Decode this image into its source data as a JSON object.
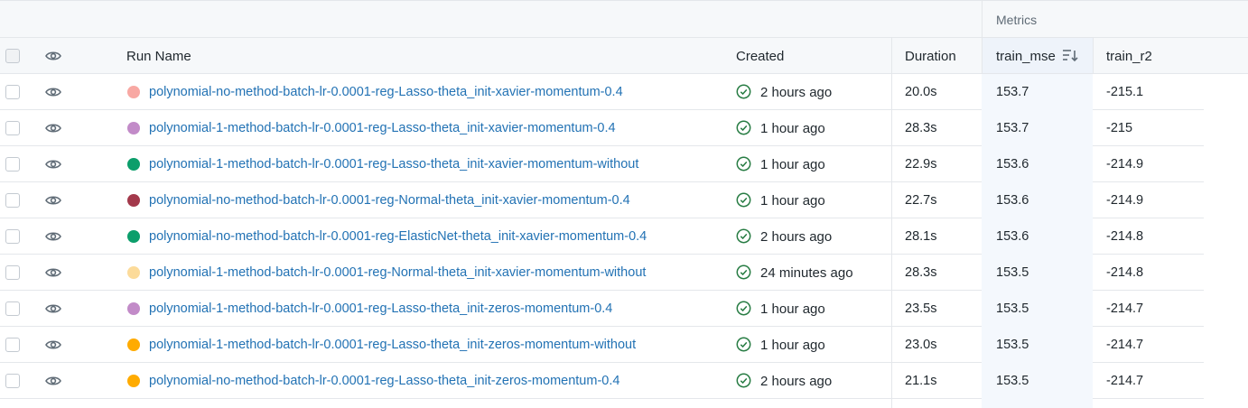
{
  "group_header": {
    "metrics": "Metrics"
  },
  "columns": {
    "run_name": "Run Name",
    "created": "Created",
    "duration": "Duration",
    "train_mse": "train_mse",
    "train_r2": "train_r2"
  },
  "sorted_column": "train_mse",
  "colors": {
    "link": "#2272b4",
    "status_success": "#277c43"
  },
  "rows": [
    {
      "name": "polynomial-no-method-batch-lr-0.0001-reg-Lasso-theta_init-xavier-momentum-0.4",
      "color": "#f8a8a3",
      "created": "2 hours ago",
      "duration": "20.0s",
      "train_mse": "153.7",
      "train_r2": "-215.1"
    },
    {
      "name": "polynomial-1-method-batch-lr-0.0001-reg-Lasso-theta_init-xavier-momentum-0.4",
      "color": "#c28bc8",
      "created": "1 hour ago",
      "duration": "28.3s",
      "train_mse": "153.7",
      "train_r2": "-215"
    },
    {
      "name": "polynomial-1-method-batch-lr-0.0001-reg-Lasso-theta_init-xavier-momentum-without",
      "color": "#0c9e6b",
      "created": "1 hour ago",
      "duration": "22.9s",
      "train_mse": "153.6",
      "train_r2": "-214.9"
    },
    {
      "name": "polynomial-no-method-batch-lr-0.0001-reg-Normal-theta_init-xavier-momentum-0.4",
      "color": "#a3394b",
      "created": "1 hour ago",
      "duration": "22.7s",
      "train_mse": "153.6",
      "train_r2": "-214.9"
    },
    {
      "name": "polynomial-no-method-batch-lr-0.0001-reg-ElasticNet-theta_init-xavier-momentum-0.4",
      "color": "#0c9e6b",
      "created": "2 hours ago",
      "duration": "28.1s",
      "train_mse": "153.6",
      "train_r2": "-214.8"
    },
    {
      "name": "polynomial-1-method-batch-lr-0.0001-reg-Normal-theta_init-xavier-momentum-without",
      "color": "#fcdb9a",
      "created": "24 minutes ago",
      "duration": "28.3s",
      "train_mse": "153.5",
      "train_r2": "-214.8"
    },
    {
      "name": "polynomial-1-method-batch-lr-0.0001-reg-Lasso-theta_init-zeros-momentum-0.4",
      "color": "#c28bc8",
      "created": "1 hour ago",
      "duration": "23.5s",
      "train_mse": "153.5",
      "train_r2": "-214.7"
    },
    {
      "name": "polynomial-1-method-batch-lr-0.0001-reg-Lasso-theta_init-zeros-momentum-without",
      "color": "#ffab00",
      "created": "1 hour ago",
      "duration": "23.0s",
      "train_mse": "153.5",
      "train_r2": "-214.7"
    },
    {
      "name": "polynomial-no-method-batch-lr-0.0001-reg-Lasso-theta_init-zeros-momentum-0.4",
      "color": "#ffab00",
      "created": "2 hours ago",
      "duration": "21.1s",
      "train_mse": "153.5",
      "train_r2": "-214.7"
    }
  ]
}
